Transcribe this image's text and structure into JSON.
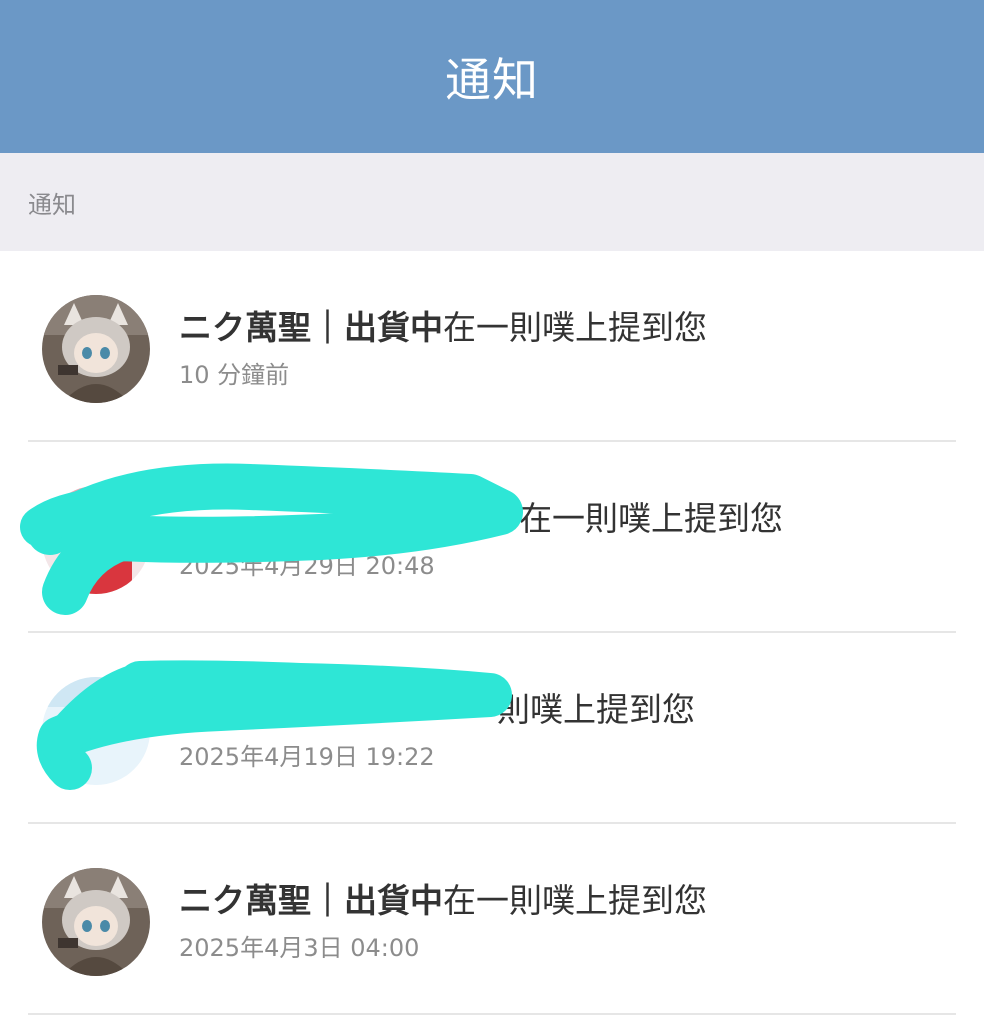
{
  "app_bar": {
    "title": "通知"
  },
  "section": {
    "title": "通知"
  },
  "notifications": [
    {
      "name": "ニク萬聖｜出貨中",
      "message": "在一則噗上提到您",
      "time": "10 分鐘前",
      "avatar_icon": "anime-figure-avatar",
      "redacted": false
    },
    {
      "name": "",
      "message": "在一則噗上提到您",
      "time": "2025年4月29日 20:48",
      "avatar_icon": "redacted-avatar",
      "redacted": true
    },
    {
      "name": "",
      "message": "則噗上提到您",
      "time": "2025年4月19日 19:22",
      "avatar_icon": "redacted-avatar",
      "redacted": true
    },
    {
      "name": "ニク萬聖｜出貨中",
      "message": "在一則噗上提到您",
      "time": "2025年4月3日 04:00",
      "avatar_icon": "anime-figure-avatar",
      "redacted": false
    }
  ],
  "colors": {
    "app_bar": "#6b98c6",
    "section_bg": "#eeedf2",
    "redaction": "#2ee6d6"
  }
}
